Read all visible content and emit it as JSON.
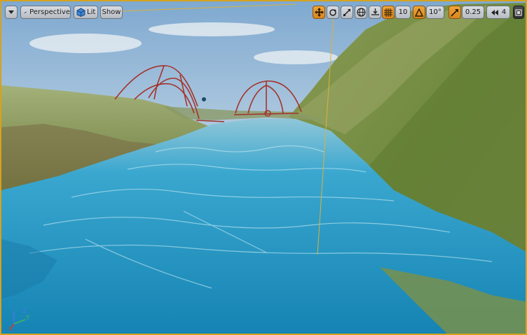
{
  "toolbar": {
    "menu_icon": "chevron-down-icon",
    "view_mode_label": "Perspective",
    "lighting_label": "Lit",
    "show_label": "Show",
    "grid_snap_value": "10",
    "rotation_snap_value": "10°",
    "scale_snap_value": "0.25",
    "camera_speed_value": "4"
  },
  "axes": {
    "z_label": "Z",
    "y_label": "Y",
    "x_label": "X"
  },
  "colors": {
    "selection_border": "#d6a21e",
    "active_tool": "#e9962a",
    "water": "#2a9fc6",
    "volume_wire": "#a52a2a"
  }
}
